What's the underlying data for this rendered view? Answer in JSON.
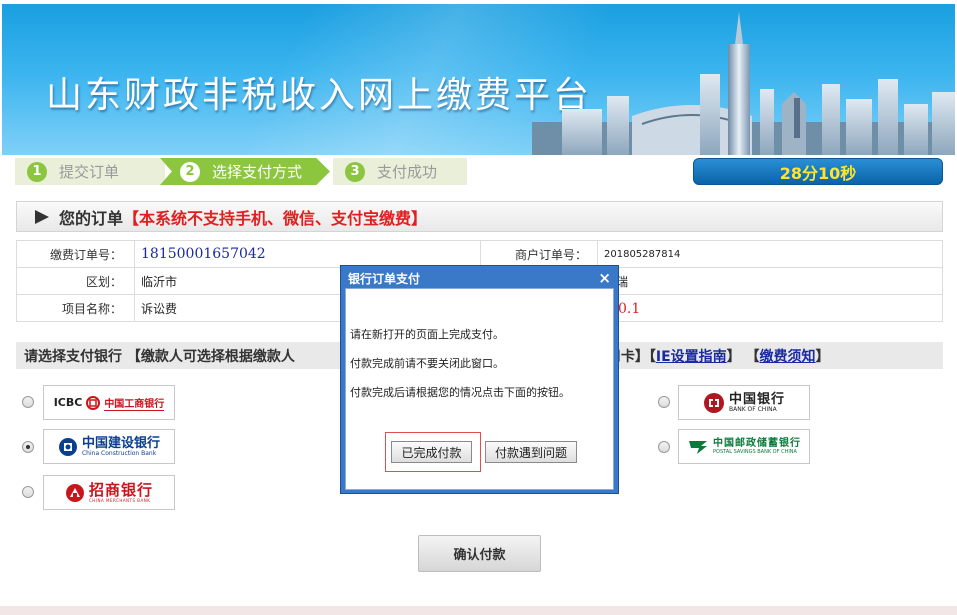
{
  "banner": {
    "title": "山东财政非税收入网上缴费平台"
  },
  "steps": [
    {
      "num": "1",
      "label": "提交订单"
    },
    {
      "num": "2",
      "label": "选择支付方式"
    },
    {
      "num": "3",
      "label": "支付成功"
    }
  ],
  "timer": "28分10秒",
  "order": {
    "heading": "您的订单",
    "notice": "【本系统不支持手机、微信、支付宝缴费】",
    "rows": [
      {
        "label1": "缴费订单号：",
        "value1": "18150001657042",
        "label2": "商户订单号：",
        "value2": "201805287814"
      },
      {
        "label1": "区划：",
        "value1": "临沂市",
        "label2": "",
        "value2": "菲瑞"
      },
      {
        "label1": "项目名称：",
        "value1": "诉讼费",
        "label2": "",
        "value2": "￥0.1"
      }
    ]
  },
  "bank_bar": {
    "prefix": "请选择支付银行 【缴款人可选择根据缴款人",
    "suffix": "不支持信用卡】【",
    "link1": "IE设置指南",
    "mid": "】 【",
    "link2": "缴费须知",
    "end": "】"
  },
  "banks": [
    {
      "id": "icbc",
      "en": "ICBC",
      "cn": "中国工商银行",
      "selected": false
    },
    {
      "id": "ccb",
      "cn": "中国建设银行",
      "en": "China Construction Bank",
      "selected": true
    },
    {
      "id": "cmb",
      "cn": "招商银行",
      "en": "CHINA MERCHANTS BANK",
      "selected": false
    },
    {
      "id": "boc",
      "cn": "中国银行",
      "en": "BANK OF CHINA",
      "selected": false
    },
    {
      "id": "psbc",
      "cn": "中国邮政储蓄银行",
      "en": "POSTAL SAVINGS BANK OF CHINA",
      "selected": false
    }
  ],
  "confirm_label": "确认付款",
  "dialog": {
    "title": "银行订单支付",
    "close": "×",
    "lines": [
      "请在新打开的页面上完成支付。",
      "付款完成前请不要关闭此窗口。",
      "付款完成后请根据您的情况点击下面的按钮。"
    ],
    "done_label": "已完成付款",
    "problem_label": "付款遇到问题"
  }
}
